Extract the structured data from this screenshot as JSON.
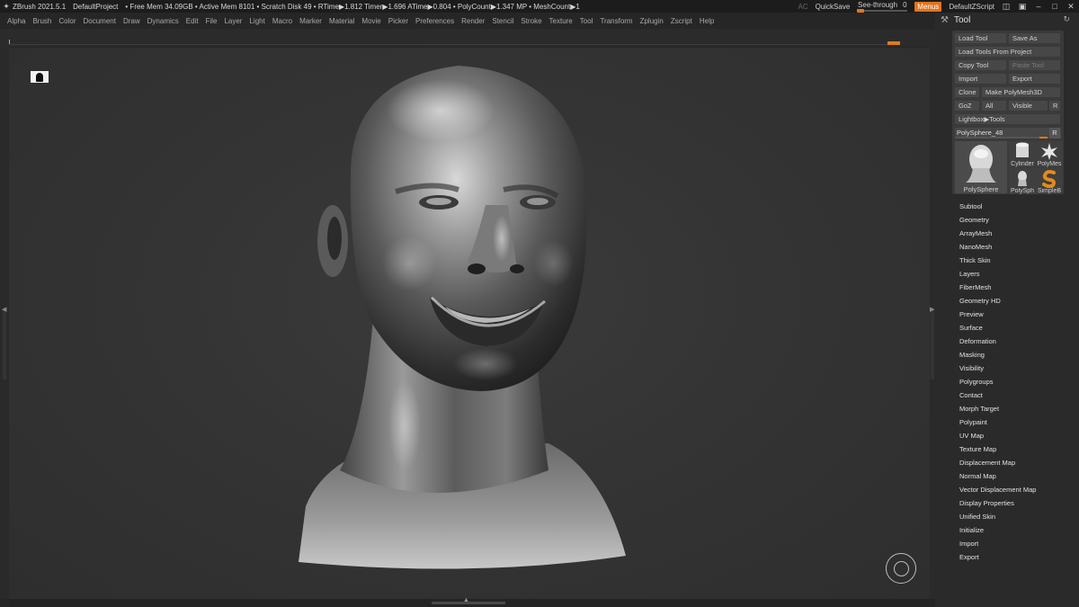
{
  "titlebar": {
    "logo": "zbrush-logo-icon",
    "app": "ZBrush 2021.5.1",
    "project": "DefaultProject",
    "stats": "• Free Mem 34.09GB • Active Mem 8101 • Scratch Disk 49 •  RTime▶1.812 Timer▶1.696 ATime▶0.804 • PolyCount▶1.347 MP  • MeshCount▶1",
    "ac": "AC",
    "quicksave": "QuickSave",
    "see_through_label": "See-through",
    "see_through_value": "0",
    "see_through_level": 0.0,
    "menus": "Menus",
    "script": "DefaultZScript"
  },
  "menubar": [
    "Alpha",
    "Brush",
    "Color",
    "Document",
    "Draw",
    "Dynamics",
    "Edit",
    "File",
    "Layer",
    "Light",
    "Macro",
    "Marker",
    "Material",
    "Movie",
    "Picker",
    "Preferences",
    "Render",
    "Stencil",
    "Stroke",
    "Texture",
    "Tool",
    "Transform",
    "Zplugin",
    "Zscript",
    "Help"
  ],
  "tool_panel": {
    "title": "Tool",
    "buttons": {
      "load_tool": "Load Tool",
      "save_as": "Save As",
      "load_from_project": "Load Tools From Project",
      "copy_tool": "Copy Tool",
      "paste_tool": "Paste Tool",
      "import": "Import",
      "export": "Export",
      "clone": "Clone",
      "make_polymesh": "Make PolyMesh3D",
      "goz": "GoZ",
      "all": "All",
      "visible": "Visible",
      "r": "R",
      "lightbox_tools": "Lightbox▶Tools"
    },
    "slider": {
      "label": "PolySphere_48",
      "r": "R"
    },
    "thumbnails": {
      "main": "PolySphere",
      "cylinder": "Cylinder",
      "polymesh": "PolyMes",
      "polysph": "PolySph",
      "simpleb": "SimpleB"
    },
    "sub_palettes": [
      "Subtool",
      "Geometry",
      "ArrayMesh",
      "NanoMesh",
      "Thick Skin",
      "Layers",
      "FiberMesh",
      "Geometry HD",
      "Preview",
      "Surface",
      "Deformation",
      "Masking",
      "Visibility",
      "Polygroups",
      "Contact",
      "Morph Target",
      "Polypaint",
      "UV Map",
      "Texture Map",
      "Displacement Map",
      "Normal Map",
      "Vector Displacement Map",
      "Display Properties",
      "Unified Skin",
      "Initialize",
      "Import",
      "Export"
    ]
  },
  "colors": {
    "accent": "#e27a18",
    "background": "#262626",
    "panel": "#2a2a2a"
  }
}
